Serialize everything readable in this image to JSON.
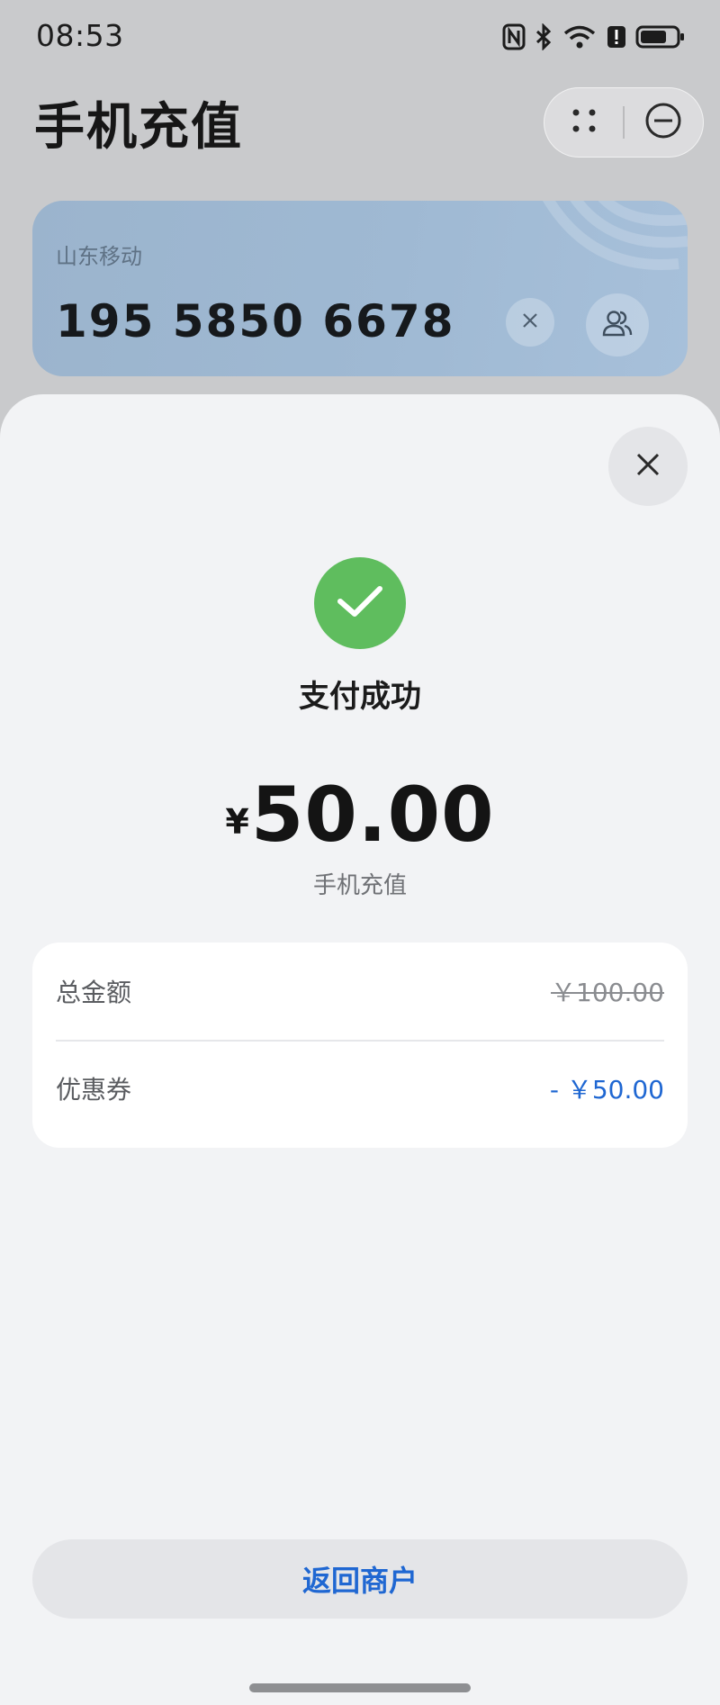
{
  "status_bar": {
    "time": "08:53",
    "icons": [
      "nfc-icon",
      "bluetooth-icon",
      "wifi-icon",
      "alert-icon",
      "battery-icon"
    ]
  },
  "header": {
    "title": "手机充值",
    "capsule": {
      "menu_icon": "more-dots-icon",
      "close_icon": "minimize-circle-icon"
    }
  },
  "phone_card": {
    "carrier": "山东移动",
    "phone_number": "195 5850 6678",
    "clear_icon": "close-icon",
    "contact_icon": "contacts-icon",
    "color": "#9fb9d3"
  },
  "result_sheet": {
    "close_icon": "close-icon",
    "status_icon": "check-icon",
    "status_text": "支付成功",
    "currency_symbol": "¥",
    "amount": "50.00",
    "amount_subtitle": "手机充值",
    "details": [
      {
        "label": "总金额",
        "value": "￥100.00",
        "style": "strikethrough"
      },
      {
        "label": "优惠券",
        "value": "- ￥50.00",
        "style": "discount"
      }
    ],
    "return_button": "返回商户"
  },
  "colors": {
    "success": "#5fbd5e",
    "accent_blue": "#1f67d2",
    "sheet_background": "#f2f3f5"
  }
}
